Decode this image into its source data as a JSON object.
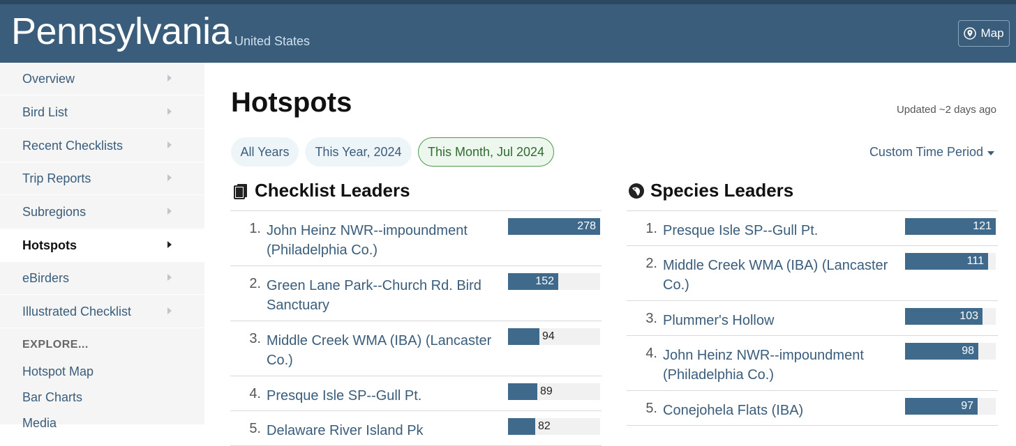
{
  "header": {
    "region": "Pennsylvania",
    "country": "United States",
    "map_label": "Map"
  },
  "sidebar": {
    "items": [
      {
        "label": "Overview",
        "active": false
      },
      {
        "label": "Bird List",
        "active": false
      },
      {
        "label": "Recent Checklists",
        "active": false
      },
      {
        "label": "Trip Reports",
        "active": false
      },
      {
        "label": "Subregions",
        "active": false
      },
      {
        "label": "Hotspots",
        "active": true
      },
      {
        "label": "eBirders",
        "active": false
      },
      {
        "label": "Illustrated Checklist",
        "active": false
      }
    ],
    "explore_heading": "EXPLORE...",
    "explore_links": [
      "Hotspot Map",
      "Bar Charts",
      "Media"
    ]
  },
  "main": {
    "title": "Hotspots",
    "updated": "Updated ~2 days ago",
    "filters": [
      {
        "label": "All Years",
        "active": false
      },
      {
        "label": "This Year, 2024",
        "active": false
      },
      {
        "label": "This Month, Jul 2024",
        "active": true
      }
    ],
    "custom_period": "Custom Time Period"
  },
  "checklist_leaders": {
    "heading": "Checklist Leaders",
    "icon": "checklist-icon",
    "max": 278,
    "rows": [
      {
        "rank": "1.",
        "lines": [
          "John Heinz NWR--impoundment",
          "(Philadelphia Co.)"
        ],
        "value": 278
      },
      {
        "rank": "2.",
        "lines": [
          "Green Lane Park--Church Rd. Bird",
          "Sanctuary"
        ],
        "value": 152
      },
      {
        "rank": "3.",
        "lines": [
          "Middle Creek WMA (IBA) (Lancaster",
          "Co.)"
        ],
        "value": 94
      },
      {
        "rank": "4.",
        "lines": [
          "Presque Isle SP--Gull Pt."
        ],
        "value": 89
      },
      {
        "rank": "5.",
        "lines": [
          "Delaware River Island Pk"
        ],
        "value": 82
      }
    ]
  },
  "species_leaders": {
    "heading": "Species Leaders",
    "icon": "bird-icon",
    "max": 121,
    "rows": [
      {
        "rank": "1.",
        "lines": [
          "Presque Isle SP--Gull Pt."
        ],
        "value": 121
      },
      {
        "rank": "2.",
        "lines": [
          "Middle Creek WMA (IBA) (Lancaster",
          "Co.)"
        ],
        "value": 111
      },
      {
        "rank": "3.",
        "lines": [
          "Plummer's Hollow"
        ],
        "value": 103
      },
      {
        "rank": "4.",
        "lines": [
          "John Heinz NWR--impoundment",
          "(Philadelphia Co.)"
        ],
        "value": 98
      },
      {
        "rank": "5.",
        "lines": [
          "Conejohela Flats (IBA)"
        ],
        "value": 97
      }
    ]
  },
  "colors": {
    "header": "#3a5d7b",
    "bar": "#3f6a8c",
    "link": "#3a5d7b",
    "active_filter": "#4a9a4a"
  }
}
